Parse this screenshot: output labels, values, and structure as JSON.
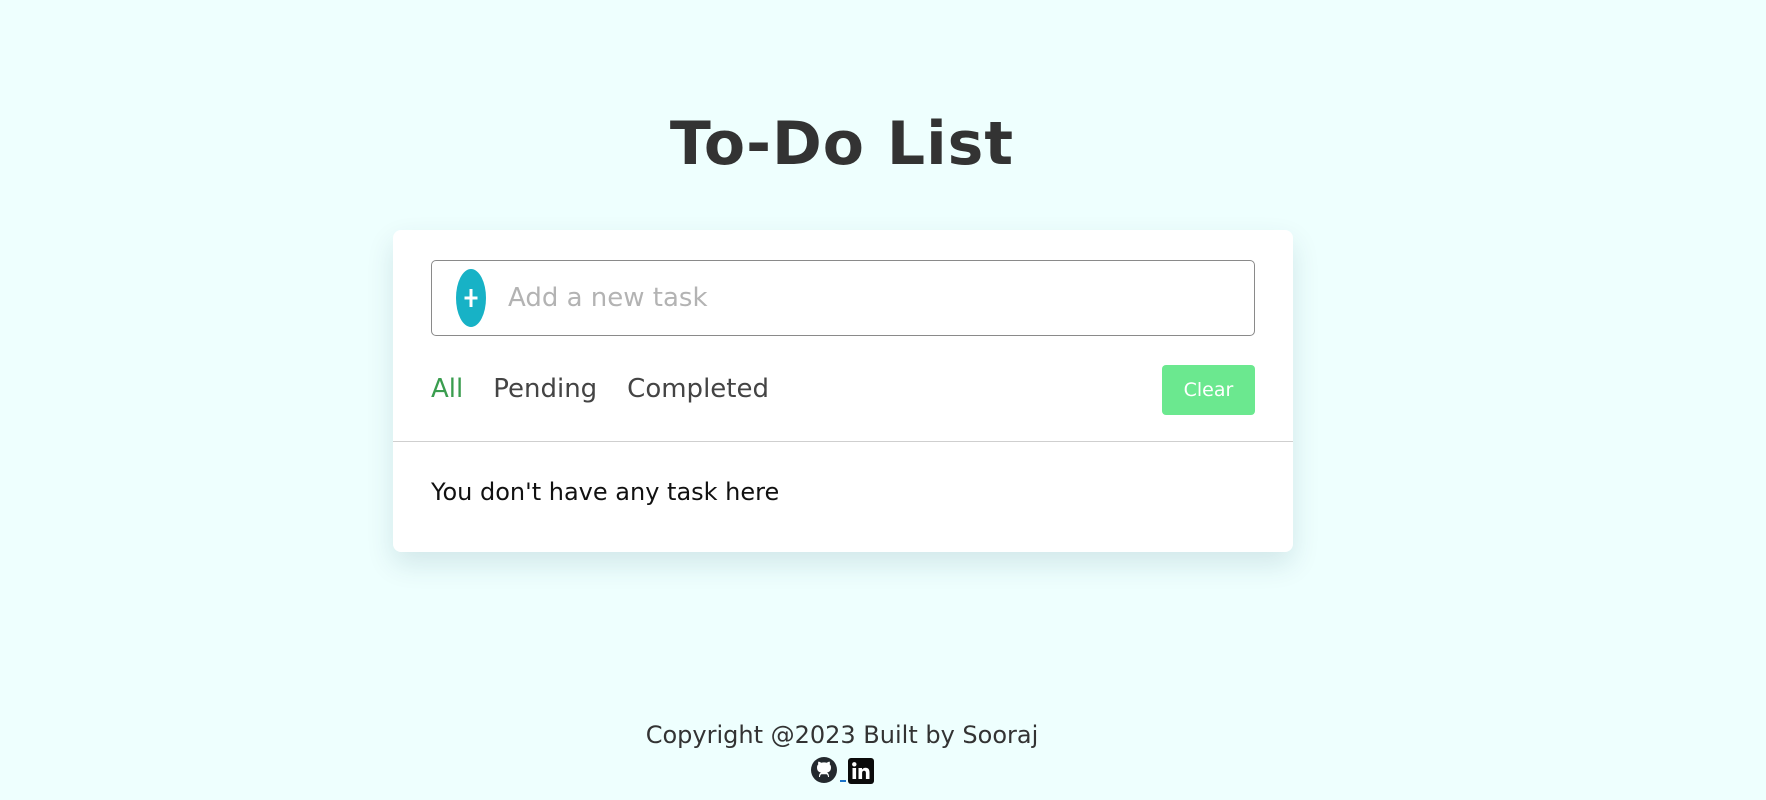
{
  "page": {
    "title": "To-Do List"
  },
  "todo": {
    "input_placeholder": "Add a new task",
    "input_value": "",
    "filters": [
      {
        "label": "All",
        "active": true
      },
      {
        "label": "Pending",
        "active": false
      },
      {
        "label": "Completed",
        "active": false
      }
    ],
    "clear_label": "Clear",
    "empty_message": "You don't have any task here"
  },
  "footer": {
    "copyright": "Copyright @2023 Built by Sooraj",
    "links": [
      {
        "icon": "github-icon"
      },
      {
        "icon": "linkedin-icon"
      }
    ]
  },
  "colors": {
    "background": "#eefffe",
    "accent_add": "#17b2c6",
    "active_filter": "#3a9d4f",
    "clear_button": "#6be88f"
  }
}
